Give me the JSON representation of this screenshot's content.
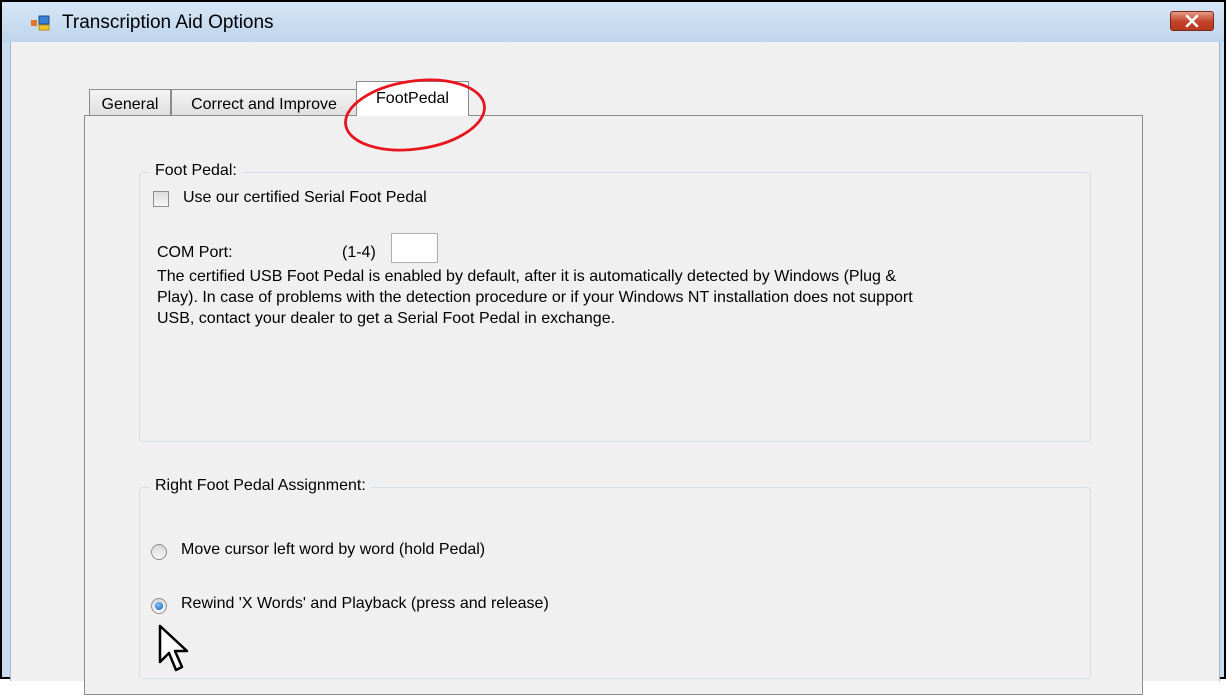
{
  "window": {
    "title": "Transcription Aid Options"
  },
  "tabs": [
    {
      "label": "General",
      "active": false
    },
    {
      "label": "Correct and Improve",
      "active": false
    },
    {
      "label": "FootPedal",
      "active": true
    }
  ],
  "foot_pedal_group": {
    "legend": "Foot Pedal:",
    "serial_checkbox": {
      "label": "Use our certified Serial Foot Pedal",
      "checked": false
    },
    "com_port": {
      "label": "COM Port:",
      "range": "(1-4)",
      "value": ""
    },
    "description_lines": [
      "The certified USB Foot Pedal is enabled by default, after it is automatically detected by Windows (Plug &",
      "Play). In case of problems with the detection procedure or if your Windows NT installation does not support",
      "USB, contact your dealer to get a Serial Foot Pedal in exchange."
    ]
  },
  "assignment_group": {
    "legend": "Right Foot Pedal Assignment:",
    "options": [
      {
        "label": "Move cursor left word by word (hold Pedal)",
        "selected": false
      },
      {
        "label": "Rewind 'X Words' and Playback (press and release)",
        "selected": true
      }
    ]
  },
  "colors": {
    "titlebar": "#c8dcef",
    "close_button": "#c4412a",
    "annotation_circle": "#e8141e",
    "radio_selected": "#1a6fc4"
  }
}
